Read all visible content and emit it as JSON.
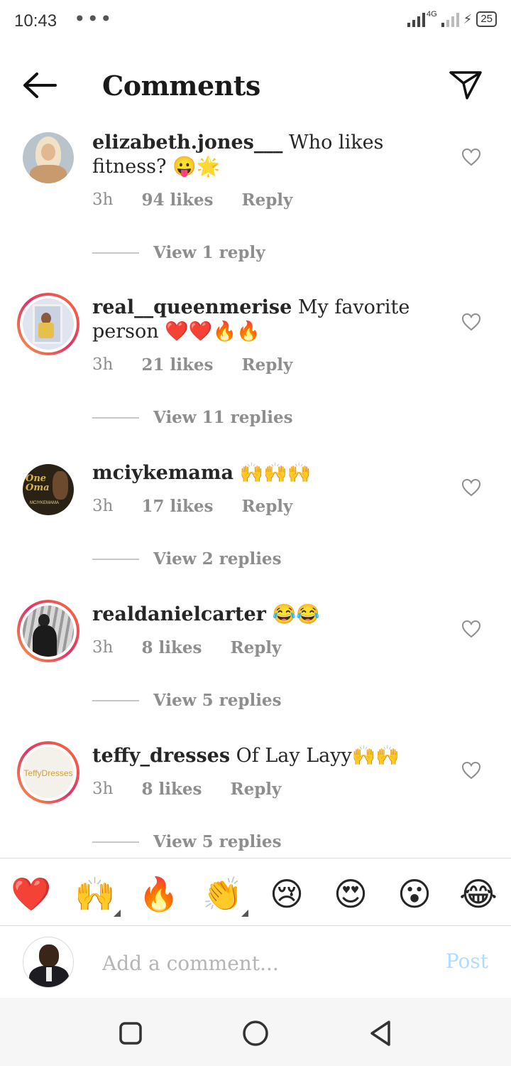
{
  "status_bar": {
    "time": "10:43",
    "dots": "•••",
    "network": "4G",
    "battery": "25"
  },
  "header": {
    "title": "Comments"
  },
  "comments": [
    {
      "username": "elizabeth.jones___",
      "text": " Who likes fitness? 😛🌟",
      "time": "3h",
      "likes": "94 likes",
      "reply": "Reply",
      "view_replies": "View 1 reply",
      "story_ring": false
    },
    {
      "username": "real__queenmerise",
      "text": " My favorite person ❤️❤️🔥🔥",
      "time": "3h",
      "likes": "21 likes",
      "reply": "Reply",
      "view_replies": "View 11 replies",
      "story_ring": true
    },
    {
      "username": "mciykemama",
      "text": " 🙌🙌🙌",
      "time": "3h",
      "likes": "17 likes",
      "reply": "Reply",
      "view_replies": "View 2 replies",
      "story_ring": false,
      "avatar_text_1": "One Oma",
      "avatar_text_2": "MCIYKEMAMA"
    },
    {
      "username": "realdanielcarter",
      "text": " 😂😂",
      "time": "3h",
      "likes": "8 likes",
      "reply": "Reply",
      "view_replies": "View 5 replies",
      "story_ring": true
    },
    {
      "username": "teffy_dresses",
      "text": " Of Lay Layy🙌🙌",
      "time": "3h",
      "likes": "8 likes",
      "reply": "Reply",
      "view_replies": "View 5 replies",
      "story_ring": true,
      "avatar_text": "TeffyDresses"
    }
  ],
  "emoji_bar": [
    "❤️",
    "🙌",
    "🔥",
    "👏",
    "😢",
    "😍",
    "😮",
    "😂"
  ],
  "composer": {
    "placeholder": "Add a comment...",
    "post_label": "Post"
  },
  "colors": {
    "story_ring": "#e1306c",
    "post_disabled": "#b3dbff",
    "secondary_text": "#8e8e8e"
  }
}
